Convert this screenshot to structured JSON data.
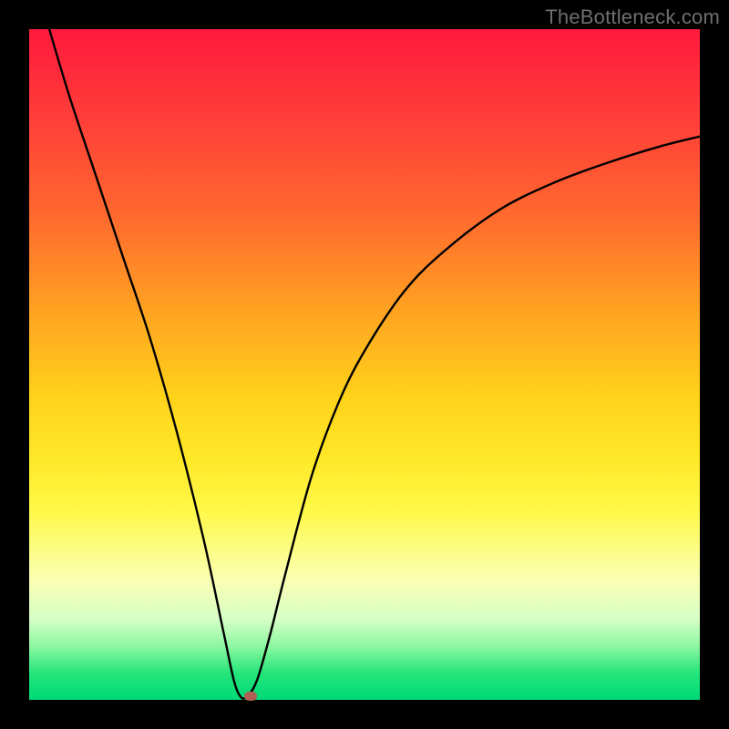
{
  "watermark": "TheBottleneck.com",
  "colors": {
    "frame": "#000000",
    "curve": "#000000",
    "marker": "#b15e54"
  },
  "chart_data": {
    "type": "line",
    "title": "",
    "xlabel": "",
    "ylabel": "",
    "xlim": [
      0,
      100
    ],
    "ylim": [
      0,
      100
    ],
    "series": [
      {
        "name": "bottleneck-curve",
        "x": [
          3,
          6,
          10,
          14,
          18,
          22,
          26,
          29,
          30.5,
          31.5,
          32.5,
          34,
          36,
          38,
          42,
          46,
          50,
          56,
          62,
          70,
          78,
          86,
          94,
          100
        ],
        "y": [
          100,
          90,
          78,
          66,
          54,
          40,
          24,
          10,
          3,
          0.5,
          0.5,
          3,
          10,
          18,
          33,
          44,
          52,
          61,
          67,
          73,
          77,
          80,
          82.5,
          84
        ]
      }
    ],
    "marker": {
      "x": 33,
      "y": 0.5
    },
    "background_gradient": {
      "top": "#ff1a3c",
      "mid": "#ffd31a",
      "bottom": "#00d977"
    }
  }
}
